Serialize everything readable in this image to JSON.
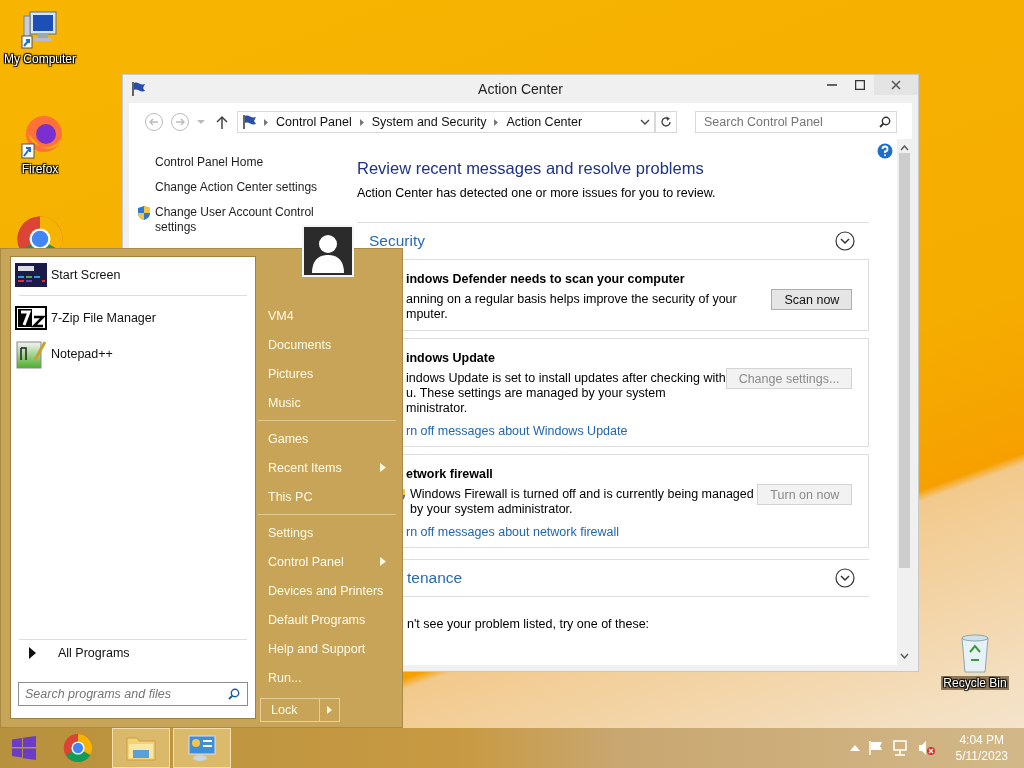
{
  "desktop_icons": [
    {
      "kind": "computer",
      "label": "My Computer"
    },
    {
      "kind": "firefox",
      "label": "Firefox"
    },
    {
      "kind": "chrome"
    }
  ],
  "recycle_bin": {
    "label": "Recycle Bin"
  },
  "window": {
    "title": "Action Center",
    "breadcrumb": [
      "Control Panel",
      "System and Security",
      "Action Center"
    ],
    "search_placeholder": "Search Control Panel",
    "nav": [
      {
        "kind": "link",
        "label": "Control Panel Home"
      },
      {
        "kind": "link",
        "label": "Change Action Center settings"
      },
      {
        "kind": "shield",
        "label": "Change User Account Control settings"
      }
    ],
    "heading": "Review recent messages and resolve problems",
    "intro": "Action Center has detected one or more issues for you to review.",
    "sections": [
      {
        "title": "Security",
        "messages": [
          {
            "kind": "plain",
            "title": "indows Defender needs to scan your computer",
            "lines": [
              "anning on a regular basis helps improve the security of your",
              "mputer."
            ],
            "button": {
              "label": "Scan now",
              "disabled": false
            }
          },
          {
            "kind": "plain",
            "title": "indows Update",
            "lines": [
              "indows Update is set to install updates after checking with",
              "u.  These settings are managed by your system",
              "ministrator."
            ],
            "link": "rn off messages about Windows Update",
            "button": {
              "label": "Change settings...",
              "disabled": true
            }
          },
          {
            "kind": "with-icon",
            "title": "etwork firewall",
            "lines": [
              "Windows Firewall is turned off and is currently being managed",
              "by your system administrator."
            ],
            "link": "rn off messages about network firewall",
            "button": {
              "label": "Turn on now",
              "disabled": true
            }
          }
        ]
      },
      {
        "title": "tenance"
      }
    ],
    "footer_text": "n't see your problem listed, try one of these:"
  },
  "start_menu": {
    "pinned": [
      {
        "kind": "start-screen",
        "label": "Start Screen"
      },
      {
        "kind": "archiver",
        "label": "7-Zip File Manager"
      },
      {
        "kind": "notepad",
        "label": "Notepad++"
      }
    ],
    "all_programs": "All Programs",
    "search_placeholder": "Search programs and files",
    "places": [
      [
        {
          "label": "VM4",
          "submenu": false
        },
        {
          "label": "Documents",
          "submenu": false
        },
        {
          "label": "Pictures",
          "submenu": false
        },
        {
          "label": "Music",
          "submenu": false
        }
      ],
      [
        {
          "label": "Games",
          "submenu": false
        },
        {
          "label": "Recent Items",
          "submenu": true
        },
        {
          "label": "This PC",
          "submenu": false
        }
      ],
      [
        {
          "label": "Settings",
          "submenu": false
        },
        {
          "label": "Control Panel",
          "submenu": true
        },
        {
          "label": "Devices and Printers",
          "submenu": false
        },
        {
          "label": "Default Programs",
          "submenu": false
        },
        {
          "label": "Help and Support",
          "submenu": false
        },
        {
          "label": "Run...",
          "submenu": false
        }
      ]
    ],
    "lock": "Lock"
  },
  "taskbar": {
    "apps": [
      {
        "kind": "chrome",
        "open": false
      },
      {
        "kind": "explorer",
        "open": true
      },
      {
        "kind": "control-panel",
        "open": true
      }
    ],
    "time": "4:04 PM",
    "date": "5/11/2023"
  }
}
